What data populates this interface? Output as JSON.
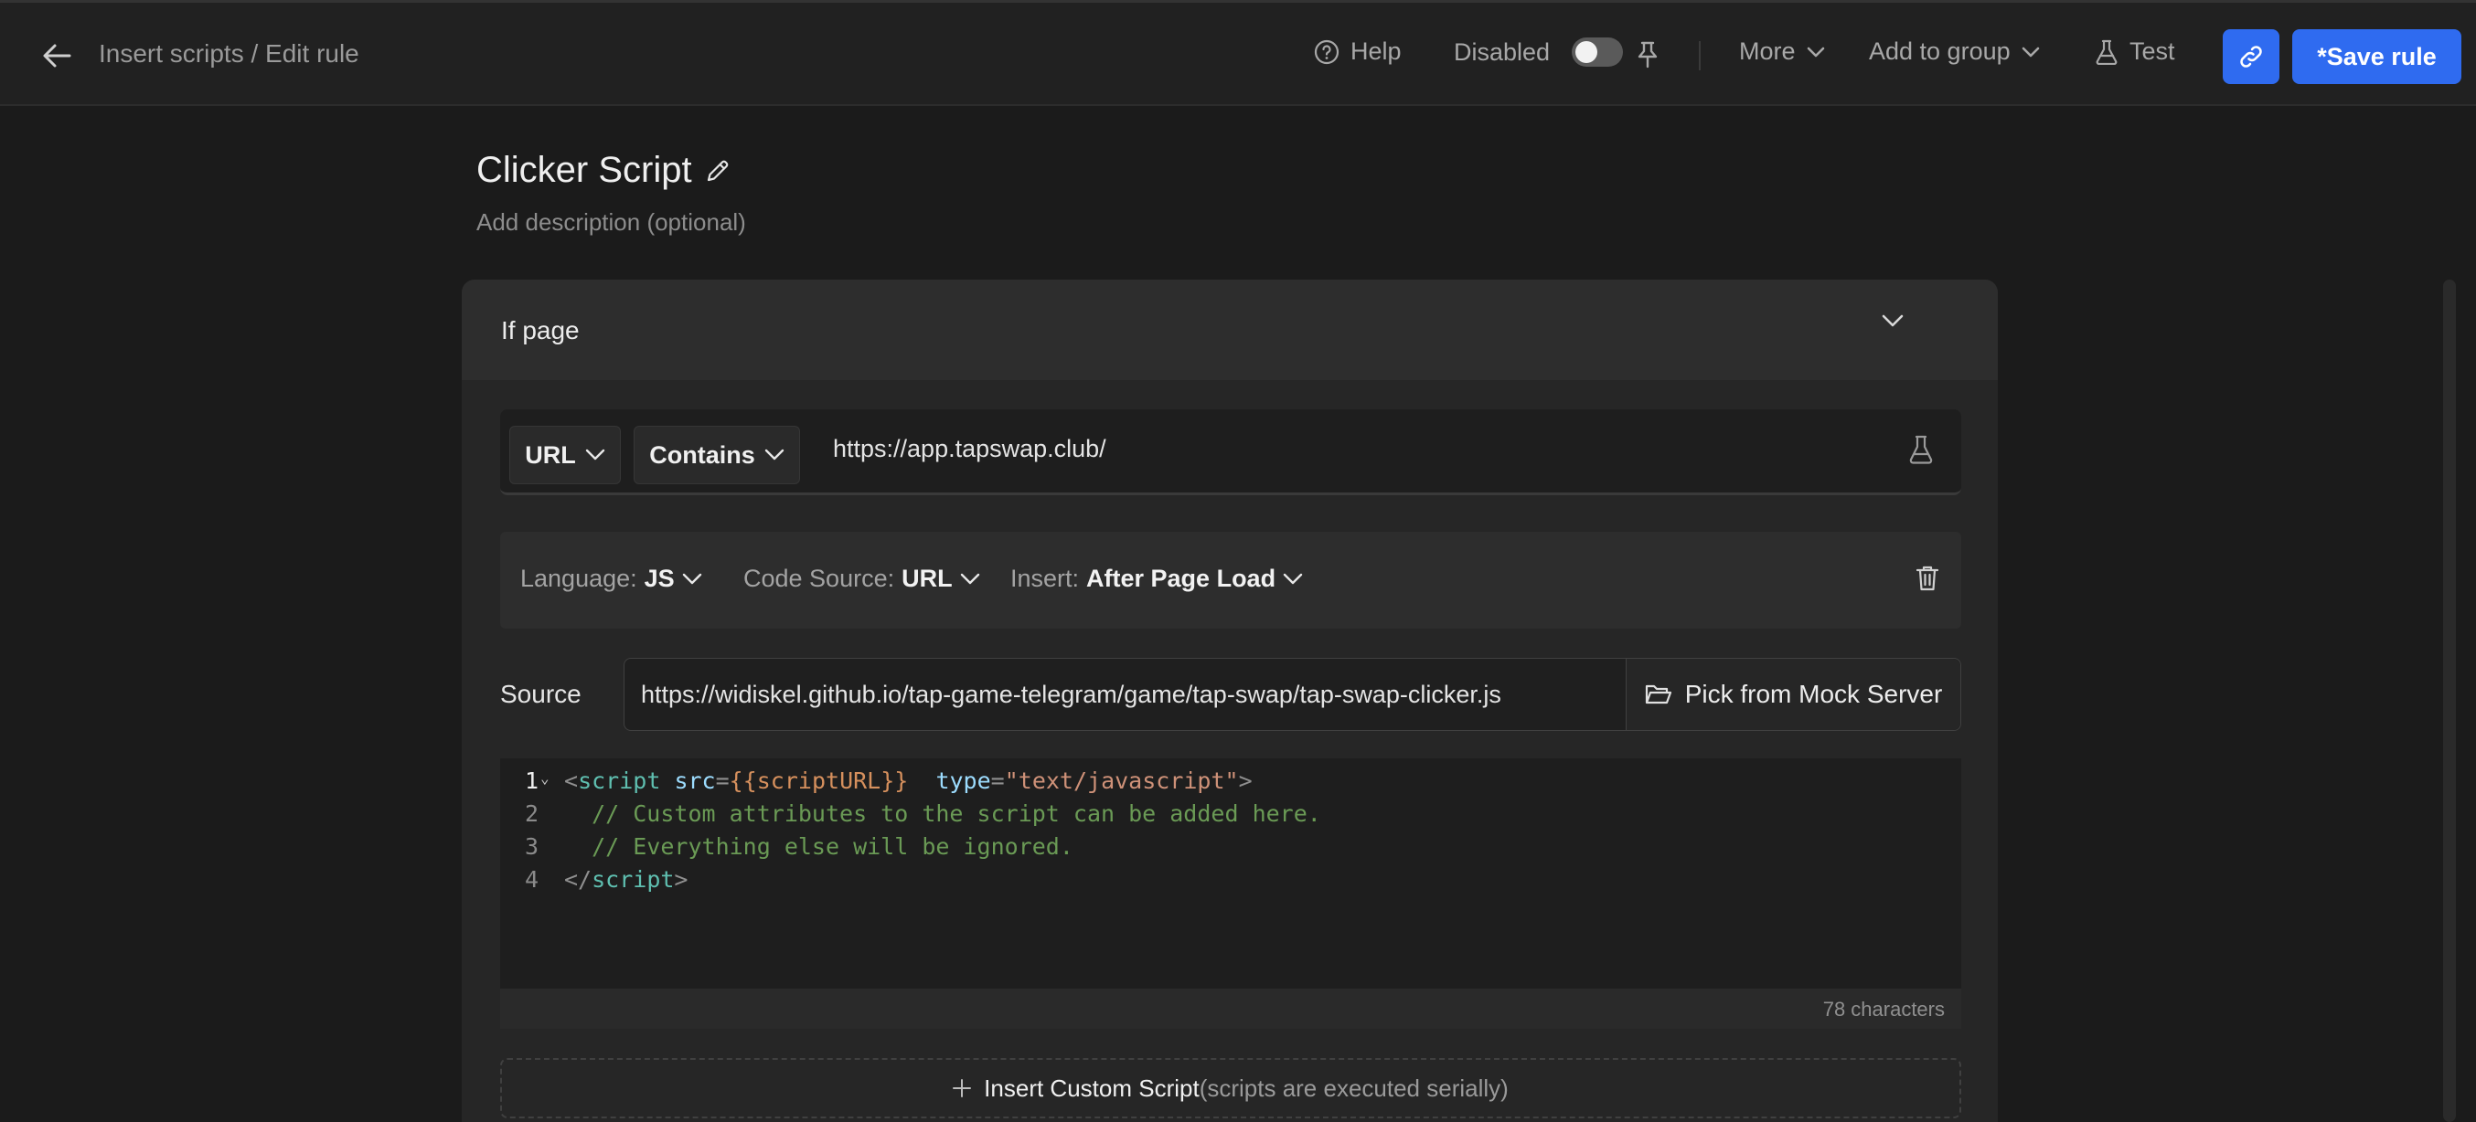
{
  "header": {
    "breadcrumb": "Insert scripts / Edit rule",
    "help_label": "Help",
    "disabled_label": "Disabled",
    "more_label": "More",
    "add_to_group_label": "Add to group",
    "test_label": "Test",
    "save_label": "*Save rule"
  },
  "rule": {
    "title": "Clicker Script",
    "description_placeholder": "Add description (optional)"
  },
  "condition": {
    "section_title": "If page",
    "match_type": "URL",
    "operator": "Contains",
    "url_value": "https://app.tapswap.club/"
  },
  "script": {
    "language_label": "Language:",
    "language_value": "JS",
    "code_source_label": "Code Source:",
    "code_source_value": "URL",
    "insert_label": "Insert:",
    "insert_value": "After Page Load",
    "source_label": "Source",
    "source_value": "https://widiskel.github.io/tap-game-telegram/game/tap-swap/tap-swap-clicker.js",
    "pick_button_label": "Pick from Mock Server",
    "code_lines": [
      {
        "num": "1",
        "open": "<",
        "tag": "script",
        "attr1": "src",
        "eq1": "=",
        "tmpl": "{{scriptURL}}",
        "attr2": "type",
        "eq2": "=",
        "str": "\"text/javascript\"",
        "close": ">"
      },
      {
        "num": "2",
        "comment": "  // Custom attributes to the script can be added here."
      },
      {
        "num": "3",
        "comment": "  // Everything else will be ignored."
      },
      {
        "num": "4",
        "open": "</",
        "tag": "script",
        "close": ">"
      }
    ],
    "char_count": "78 characters"
  },
  "insert_custom": {
    "label": "Insert Custom Script",
    "hint": "(scripts are executed serially)"
  },
  "colors": {
    "primary": "#2f6bf0",
    "background": "#1b1b1b",
    "header": "#212121"
  }
}
